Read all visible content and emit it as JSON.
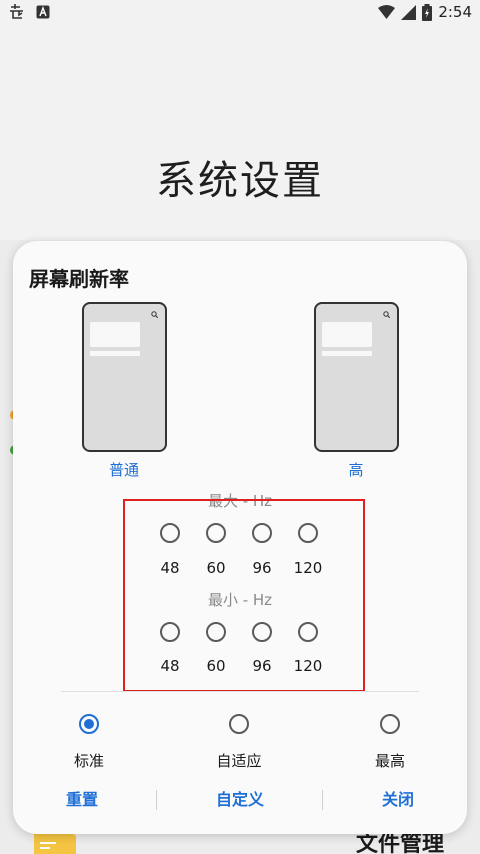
{
  "status_bar": {
    "time": "2:54"
  },
  "background": {
    "title": "系统设置",
    "file_manager_label": "文件管理"
  },
  "dialog": {
    "title": "屏幕刷新率",
    "phones": [
      {
        "label": "普通"
      },
      {
        "label": "高"
      }
    ],
    "max_label": "最大 - Hz",
    "min_label": "最小 - Hz",
    "max_options": [
      "48",
      "60",
      "96",
      "120"
    ],
    "min_options": [
      "48",
      "60",
      "96",
      "120"
    ],
    "modes": [
      {
        "label": "标准",
        "selected": true
      },
      {
        "label": "自适应",
        "selected": false
      },
      {
        "label": "最高",
        "selected": false
      }
    ],
    "buttons": {
      "reset": "重置",
      "custom": "自定义",
      "close": "关闭"
    }
  },
  "colors": {
    "accent": "#1f6fd6",
    "highlight": "#e0201e"
  }
}
